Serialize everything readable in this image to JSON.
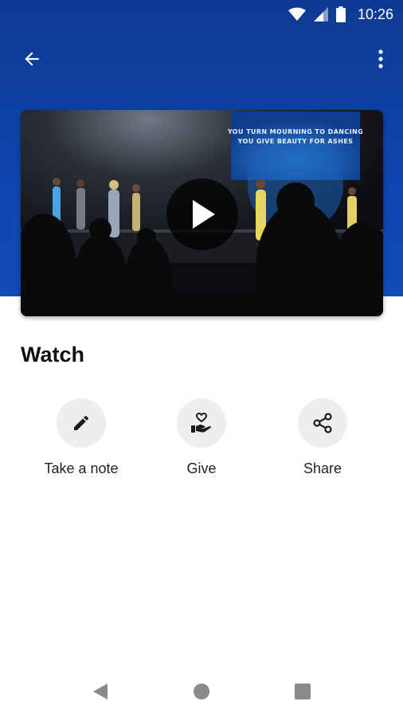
{
  "status_bar": {
    "time": "10:26",
    "icons": [
      "wifi-icon",
      "signal-icon",
      "battery-icon"
    ]
  },
  "app_bar": {
    "back_icon": "arrow-back-icon",
    "more_icon": "more-vert-icon"
  },
  "video": {
    "screen_line_1": "YOU TURN MOURNING TO DANCING",
    "screen_line_2": "YOU GIVE BEAUTY FOR ASHES",
    "play_icon": "play-icon"
  },
  "page": {
    "title": "Watch"
  },
  "actions": [
    {
      "label": "Take a note",
      "icon": "pencil-icon"
    },
    {
      "label": "Give",
      "icon": "heart-hand-icon"
    },
    {
      "label": "Share",
      "icon": "share-icon"
    }
  ],
  "nav_bar": {
    "icons": [
      "back-triangle-icon",
      "home-circle-icon",
      "recents-square-icon"
    ]
  },
  "colors": {
    "header_blue": "#0f45ae",
    "action_bg": "#eeeeee",
    "text": "#111111"
  }
}
